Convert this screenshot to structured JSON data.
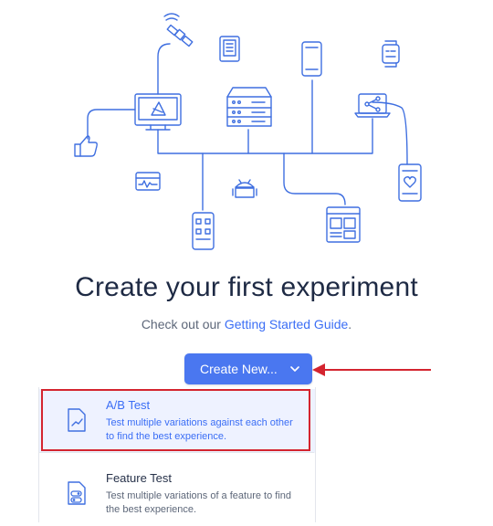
{
  "headline": "Create your first experiment",
  "subline": {
    "prefix": "Check out our ",
    "link_text": "Getting Started Guide",
    "suffix": "."
  },
  "create_button": {
    "label": "Create New..."
  },
  "menu": {
    "items": [
      {
        "title": "A/B Test",
        "description": "Test multiple variations against each other to find the best experience.",
        "icon": "chart-document-icon"
      },
      {
        "title": "Feature Test",
        "description": "Test multiple variations of a feature to find the best experience.",
        "icon": "toggle-document-icon"
      }
    ]
  },
  "colors": {
    "accent": "#4a77f0",
    "link": "#3b6ef5",
    "annotation_red": "#d4242f",
    "icon_blue": "#3f6fe0"
  },
  "illustration_icons": [
    "satellite-icon",
    "tablet-icon",
    "phone-icon",
    "smartwatch-icon",
    "monitor-icon",
    "server-icon",
    "laptop-share-icon",
    "thumbs-up-icon",
    "activity-window-icon",
    "android-robot-icon",
    "qr-phone-icon",
    "web-layout-icon",
    "heart-phone-icon"
  ]
}
